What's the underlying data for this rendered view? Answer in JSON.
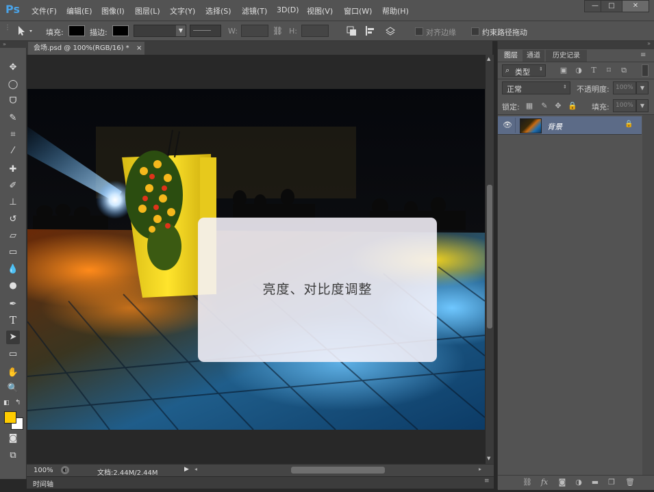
{
  "app": {
    "logo": "Ps"
  },
  "menu": [
    "文件(F)",
    "编辑(E)",
    "图像(I)",
    "图层(L)",
    "文字(Y)",
    "选择(S)",
    "滤镜(T)",
    "3D(D)",
    "视图(V)",
    "窗口(W)",
    "帮助(H)"
  ],
  "window_controls": {
    "minimize": "—",
    "restore": "□",
    "close": "✕"
  },
  "options": {
    "fill_label": "填充:",
    "stroke_label": "描边:",
    "w_label": "W:",
    "h_label": "H:",
    "align_edges": "对齐边缘",
    "constrain_path": "约束路径拖动"
  },
  "document": {
    "tab_title": "会场.psd @ 100%(RGB/16) *",
    "tab_close": "×"
  },
  "dialog": {
    "text": "亮度、对比度调整"
  },
  "status": {
    "zoom": "100%",
    "doc_info": "文档:2.44M/2.44M",
    "timeline": "时间轴"
  },
  "panel": {
    "tabs": [
      "图层",
      "通道",
      "历史记录"
    ],
    "filter_kind": "类型",
    "blend_mode": "正常",
    "opacity_label": "不透明度:",
    "opacity_value": "100%",
    "lock_label": "锁定:",
    "fill_label": "填充:",
    "fill_value": "100%",
    "layers": [
      {
        "name": "背景",
        "visible": true,
        "locked": true
      }
    ]
  },
  "colors": {
    "foreground": "#ffcc00",
    "background": "#ffffff",
    "layer_selected": "#5c6b87"
  }
}
